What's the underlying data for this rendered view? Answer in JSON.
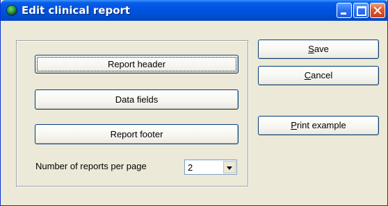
{
  "window": {
    "title": "Edit clinical report"
  },
  "group": {
    "report_header": "Report header",
    "data_fields": "Data fields",
    "report_footer": "Report footer",
    "reports_per_page_label": "Number of reports per page",
    "reports_per_page_value": "2"
  },
  "actions": {
    "save_prefix": "S",
    "save_rest": "ave",
    "cancel_prefix": "C",
    "cancel_rest": "ancel",
    "print_prefix": "P",
    "print_rest": "rint example"
  }
}
